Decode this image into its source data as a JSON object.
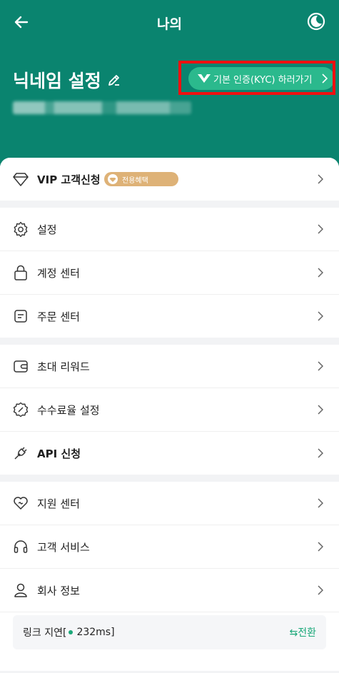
{
  "header": {
    "title": "나의",
    "nickname": "닉네임 설정",
    "kyc_button": "기본 인증(KYC) 하러가기",
    "back_icon": "arrow-left-icon",
    "theme_icon": "moon-icon",
    "accent_color": "#0a846f",
    "kyc_color": "#2bb98d",
    "highlight_color": "#ee1010"
  },
  "vip": {
    "label": "VIP 고객신청",
    "badge": "전용혜택",
    "badge_color": "#deb277"
  },
  "menu": {
    "settings": "설정",
    "account_center": "계정 센터",
    "order_center": "주문 센터",
    "invite_rewards": "초대 리워드",
    "fee_settings": "수수료율 설정",
    "api_apply": "API 신청",
    "support_center": "지원 센터",
    "customer_service": "고객 서비스",
    "company_info": "회사 정보"
  },
  "latency": {
    "prefix": "링크 지연[",
    "value": "232ms]",
    "switch_label": "⇆전환"
  }
}
